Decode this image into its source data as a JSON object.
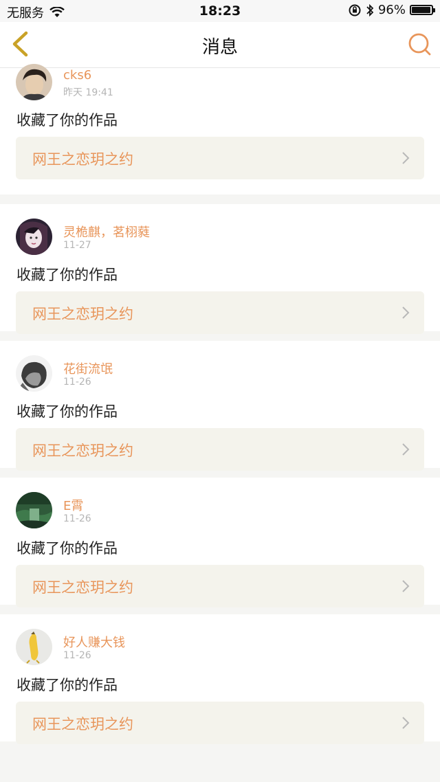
{
  "status_bar": {
    "carrier": "无服务",
    "time": "18:23",
    "battery": "96%",
    "battery_level": 0.96
  },
  "nav": {
    "title": "消息",
    "back_icon": "chevron-left-icon",
    "search_icon": "search-icon"
  },
  "colors": {
    "accent": "#e8955a",
    "back": "#c9a227",
    "card_bg": "#f4f3ec"
  },
  "messages": [
    {
      "user": "cks6",
      "time": "昨天 19:41",
      "action": "收藏了你的作品",
      "work": "网王之恋玥之约"
    },
    {
      "user": "灵桅麒，茗栩蕤",
      "time": "11-27",
      "action": "收藏了你的作品",
      "work": "网王之恋玥之约"
    },
    {
      "user": "花街流氓",
      "time": "11-26",
      "action": "收藏了你的作品",
      "work": "网王之恋玥之约"
    },
    {
      "user": "E霄",
      "time": "11-26",
      "action": "收藏了你的作品",
      "work": "网王之恋玥之约"
    },
    {
      "user": "好人赚大钱",
      "time": "11-26",
      "action": "收藏了你的作品",
      "work": "网王之恋玥之约"
    }
  ]
}
